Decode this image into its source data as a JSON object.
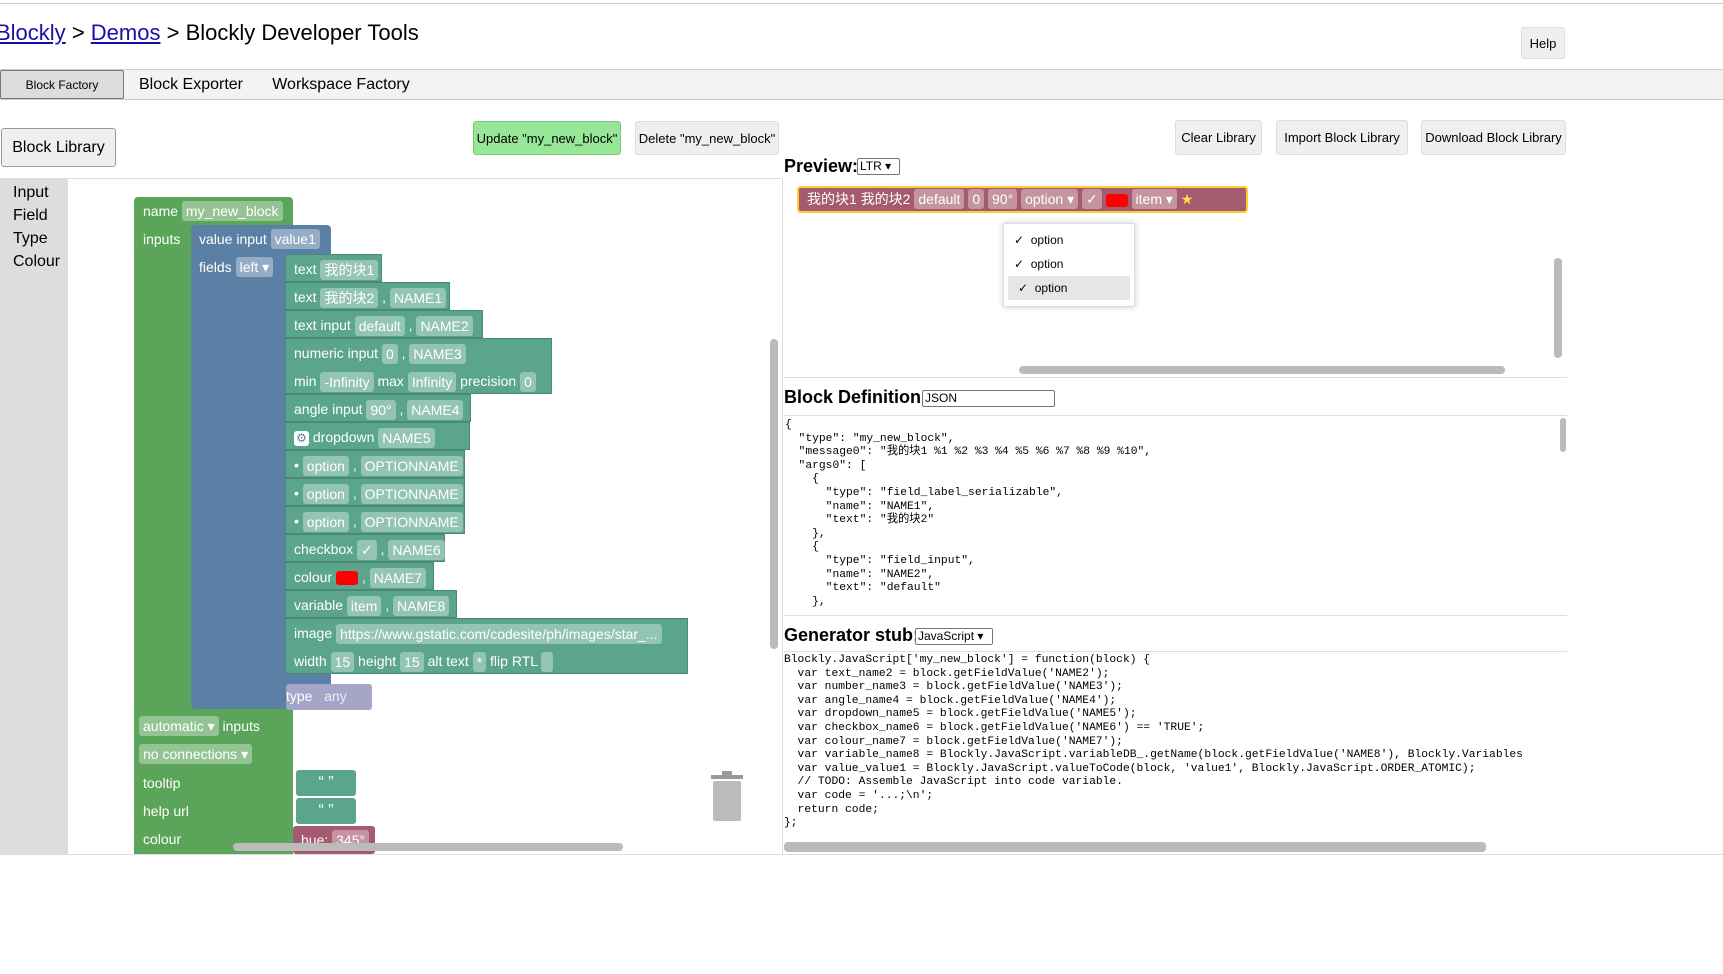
{
  "header": {
    "crumb1": "Blockly",
    "crumb2": "Demos",
    "sep": " > ",
    "title": "Blockly Developer Tools",
    "help": "Help"
  },
  "tabs": [
    "Block Factory",
    "Block Exporter",
    "Workspace Factory"
  ],
  "toolbar": {
    "block_library": "Block Library",
    "update": "Update \"my_new_block\"",
    "delete": "Delete \"my_new_block\"",
    "clear": "Clear Library",
    "import": "Import Block Library",
    "download": "Download Block Library"
  },
  "categories": [
    "Input",
    "Field",
    "Type",
    "Colour"
  ],
  "workspace": {
    "name_label": "name",
    "block_name": "my_new_block",
    "inputs_label": "inputs",
    "value_input_label": "value input",
    "value_input_name": "value1",
    "fields_label": "fields",
    "fields_align": "left ▾",
    "type_label": "type",
    "type_value": "any",
    "fields": [
      {
        "a": "text",
        "b": "我的块1"
      },
      {
        "a": "text",
        "b": "我的块2",
        "c": "NAME1"
      },
      {
        "a": "text input",
        "b": "default",
        "c": "NAME2"
      },
      {
        "a": "numeric input",
        "b": "0",
        "c": "NAME3",
        "d": "min",
        "e": "-Infinity",
        "f": "max",
        "g": "Infinity",
        "h": "precision",
        "i": "0"
      },
      {
        "a": "angle input",
        "b": "90°",
        "c": "NAME4"
      },
      {
        "a": "dropdown",
        "b": "NAME5"
      },
      {
        "a": "checkbox",
        "b": "✓",
        "c": "NAME6"
      },
      {
        "a": "colour",
        "c": "NAME7"
      },
      {
        "a": "variable",
        "b": "item",
        "c": "NAME8"
      },
      {
        "a": "image",
        "b": "https://www.gstatic.com/codesite/ph/images/star_...",
        "c": "width",
        "d": "15",
        "e": "height",
        "f": "15",
        "g": "alt text",
        "h": "*",
        "i": "flip RTL"
      }
    ],
    "options": [
      {
        "a": "option",
        "b": "OPTIONNAME"
      },
      {
        "a": "option",
        "b": "OPTIONNAME"
      },
      {
        "a": "option",
        "b": "OPTIONNAME"
      }
    ],
    "input_mode": "automatic ▾",
    "connections": "no connections ▾",
    "tooltip_label": "tooltip",
    "help_url_label": "help url",
    "colour_label": "colour",
    "hue_label": "hue:",
    "hue_value": "345°"
  },
  "preview": {
    "heading": "Preview:",
    "direction": "LTR ▾",
    "block": [
      "我的块1",
      "我的块2",
      "default",
      "0",
      "90°",
      "option ▾",
      "✓",
      "item ▾"
    ],
    "menu": [
      "option",
      "option",
      "option"
    ]
  },
  "definition": {
    "heading": "Block Definition:",
    "format": "JSON",
    "code": "{\n  \"type\": \"my_new_block\",\n  \"message0\": \"我的块1 %1 %2 %3 %4 %5 %6 %7 %8 %9 %10\",\n  \"args0\": [\n    {\n      \"type\": \"field_label_serializable\",\n      \"name\": \"NAME1\",\n      \"text\": \"我的块2\"\n    },\n    {\n      \"type\": \"field_input\",\n      \"name\": \"NAME2\",\n      \"text\": \"default\"\n    },"
  },
  "generator": {
    "heading": "Generator stub:",
    "language": "JavaScript ▾",
    "code": "Blockly.JavaScript['my_new_block'] = function(block) {\n  var text_name2 = block.getFieldValue('NAME2');\n  var number_name3 = block.getFieldValue('NAME3');\n  var angle_name4 = block.getFieldValue('NAME4');\n  var dropdown_name5 = block.getFieldValue('NAME5');\n  var checkbox_name6 = block.getFieldValue('NAME6') == 'TRUE';\n  var colour_name7 = block.getFieldValue('NAME7');\n  var variable_name8 = Blockly.JavaScript.variableDB_.getName(block.getFieldValue('NAME8'), Blockly.Variables\n  var value_value1 = Blockly.JavaScript.valueToCode(block, 'value1', Blockly.JavaScript.ORDER_ATOMIC);\n  // TODO: Assemble JavaScript into code variable.\n  var code = '...;\\n';\n  return code;\n};"
  }
}
